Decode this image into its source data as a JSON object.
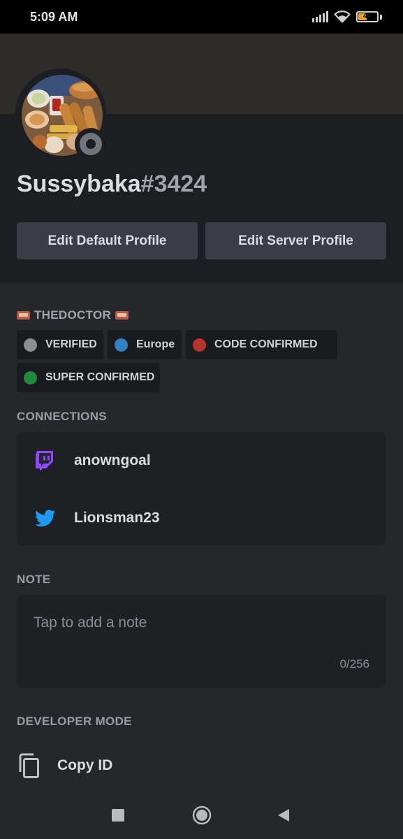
{
  "status_bar": {
    "time": "5:09 AM",
    "battery_level": "42",
    "battery_fraction": 0.42,
    "icons": [
      "signal-icon",
      "wifi-icon",
      "battery-icon"
    ]
  },
  "profile": {
    "username": "Sussybaka",
    "discriminator": "#3424",
    "avatar_icon": "food-platter-avatar",
    "status": "offline",
    "status_color": "#6f747d"
  },
  "buttons": {
    "edit_default": "Edit Default Profile",
    "edit_server": "Edit Server Profile"
  },
  "roles": {
    "title": "THEDOCTOR",
    "items": [
      {
        "label": "VERIFIED",
        "color": "#8b9091"
      },
      {
        "label": "Europe",
        "color": "#3480c4"
      },
      {
        "label": "CODE CONFIRMED",
        "color": "#b5342a"
      },
      {
        "label": "SUPER CONFIRMED",
        "color": "#1f8a3b"
      }
    ]
  },
  "connections": {
    "title": "CONNECTIONS",
    "items": [
      {
        "service": "twitch-icon",
        "name": "anowngoal",
        "color": "#9146ff"
      },
      {
        "service": "twitter-icon",
        "name": "Lionsman23",
        "color": "#1d9bf0"
      }
    ]
  },
  "note": {
    "title": "NOTE",
    "placeholder": "Tap to add a note",
    "counter": "0/256"
  },
  "developer": {
    "title": "DEVELOPER MODE",
    "copy_id": "Copy ID"
  },
  "nav": {
    "icons": [
      "recents-square-icon",
      "home-circle-icon",
      "back-triangle-icon"
    ]
  }
}
